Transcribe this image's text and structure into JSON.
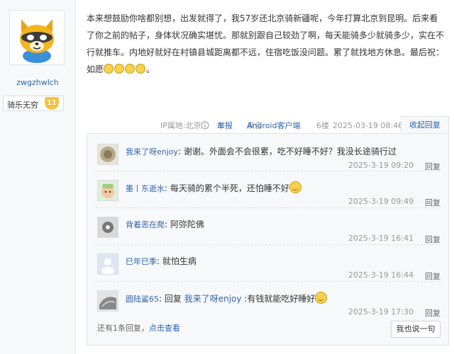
{
  "author": {
    "name": "zwgzhwlch",
    "badge_label": "骑乐无穷",
    "level": "11"
  },
  "post": {
    "text": "本来想鼓励你啥都别想，出发就得了，我57岁还北京骑新疆呢，今年打算北京到昆明。后来看了你之前的帖子，身体状况确实堪忧。那就别跟自己较劲了啊，每天能骑多少就骑多少，实在不行就推车。内地好就好在村镇县城距离都不远，住宿吃饭没问题。累了就找地方休息。最后祝：如愿"
  },
  "meta": {
    "ip": "IP属地:北京",
    "report": "举报",
    "client_prefix": "来自",
    "client": "Android客户端",
    "floor": "6楼",
    "datetime": "2025-03-19 08:46",
    "collapse": "收起回复"
  },
  "replies": [
    {
      "user": "我来了呀enjoy",
      "text": "谢谢。外面会不会很累，吃不好睡不好？我没长途骑行过",
      "time": "2025-3-19 09:20",
      "reply": "回复"
    },
    {
      "user": "墨丨东逝水",
      "text": "每天骑的累个半死，还怕睡不好",
      "time": "2025-3-19 09:49",
      "reply": "回复"
    },
    {
      "user": "背着恶在爬",
      "text": "阿弥陀佛",
      "time": "2025-3-19 16:41",
      "reply": "回复"
    },
    {
      "user": "巳年巳季",
      "text": "就怕生病",
      "time": "2025-3-19 16:44",
      "reply": "回复"
    },
    {
      "user": "圆陆鲨65",
      "prefix": "回复",
      "target": "我来了呀enjoy",
      "text": "有钱就能吃好睡好",
      "time": "2025-3-19 17:30",
      "reply": "回复"
    }
  ],
  "footer": {
    "count_text": "还有1条回复，",
    "view_link": "点击查看",
    "say_button": "我也说一句"
  },
  "colors": {
    "link": "#2d64b3",
    "panel_bg": "#f7f8fa",
    "badge": "#f5c43a"
  }
}
